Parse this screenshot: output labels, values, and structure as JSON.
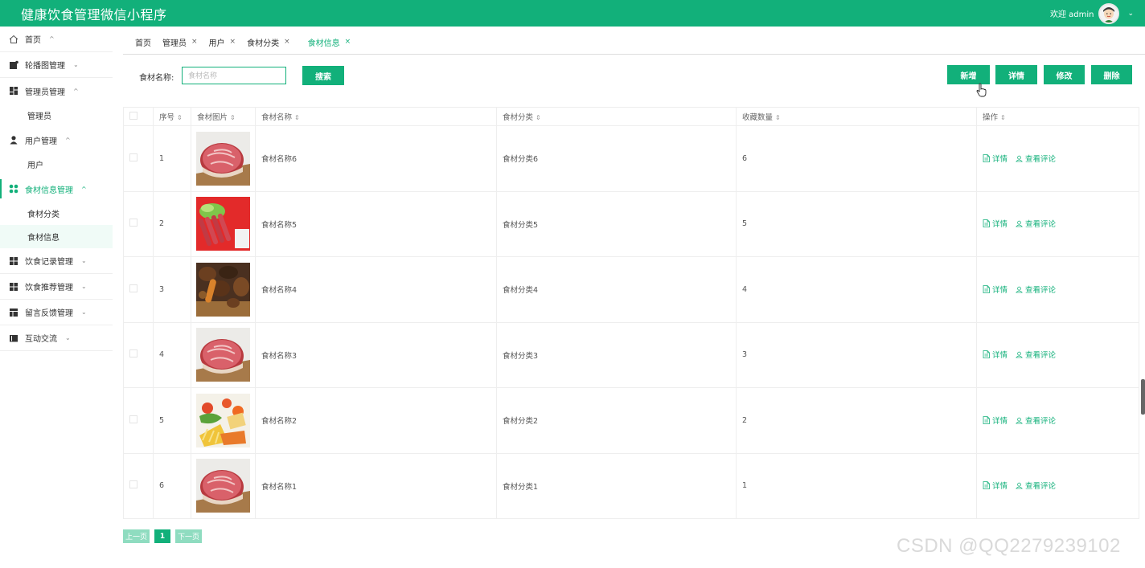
{
  "header": {
    "title": "健康饮食管理微信小程序",
    "welcome": "欢迎 admin"
  },
  "sidebar": {
    "items": [
      {
        "label": "首页",
        "arrow": "^"
      },
      {
        "label": "轮播图管理",
        "arrow": "⌄"
      },
      {
        "label": "管理员管理",
        "arrow": "^"
      },
      {
        "label": "管理员"
      },
      {
        "label": "用户管理",
        "arrow": "^"
      },
      {
        "label": "用户"
      },
      {
        "label": "食材信息管理",
        "arrow": "^"
      },
      {
        "label": "食材分类"
      },
      {
        "label": "食材信息"
      },
      {
        "label": "饮食记录管理",
        "arrow": "⌄"
      },
      {
        "label": "饮食推荐管理",
        "arrow": "⌄"
      },
      {
        "label": "留言反馈管理",
        "arrow": "⌄"
      },
      {
        "label": "互动交流",
        "arrow": "⌄"
      }
    ]
  },
  "tabs": [
    {
      "label": "首页"
    },
    {
      "label": "管理员",
      "close": "×"
    },
    {
      "label": "用户",
      "close": "×"
    },
    {
      "label": "食材分类",
      "close": "×"
    },
    {
      "label": "食材信息",
      "close": "×"
    }
  ],
  "search": {
    "label": "食材名称:",
    "placeholder": "食材名称",
    "button": "搜索"
  },
  "toolbar": {
    "add": "新增",
    "detail": "详情",
    "edit": "修改",
    "delete": "删除"
  },
  "table": {
    "headers": [
      "序号",
      "食材图片",
      "食材名称",
      "食材分类",
      "收藏数量",
      "操作"
    ],
    "rows": [
      {
        "no": "1",
        "img": "meat",
        "name": "食材名称6",
        "category": "食材分类6",
        "count": "6"
      },
      {
        "no": "2",
        "img": "sausage",
        "name": "食材名称5",
        "category": "食材分类5",
        "count": "5"
      },
      {
        "no": "3",
        "img": "grill",
        "name": "食材名称4",
        "category": "食材分类4",
        "count": "4"
      },
      {
        "no": "4",
        "img": "meat",
        "name": "食材名称3",
        "category": "食材分类3",
        "count": "3"
      },
      {
        "no": "5",
        "img": "veggies",
        "name": "食材名称2",
        "category": "食材分类2",
        "count": "2"
      },
      {
        "no": "6",
        "img": "meat",
        "name": "食材名称1",
        "category": "食材分类1",
        "count": "1"
      }
    ],
    "op_detail": "详情",
    "op_comments": "查看评论"
  },
  "pager": {
    "prev": "上一页",
    "current": "1",
    "next": "下一页"
  },
  "watermark": "CSDN @QQ2279239102",
  "colors": {
    "accent": "#12b07a"
  }
}
